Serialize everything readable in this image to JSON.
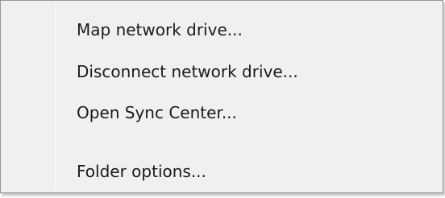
{
  "context_menu": {
    "items": [
      {
        "label": "Map network drive..."
      },
      {
        "label": "Disconnect network drive..."
      },
      {
        "label": "Open Sync Center..."
      }
    ],
    "footer_items": [
      {
        "label": "Folder options..."
      }
    ]
  }
}
